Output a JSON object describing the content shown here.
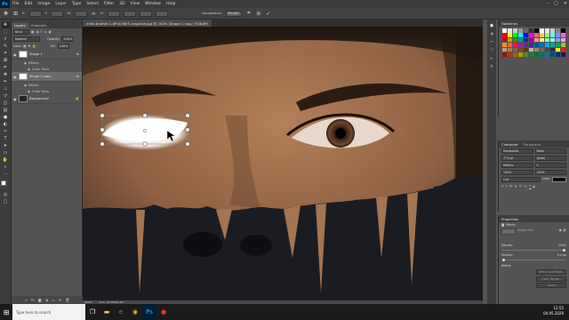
{
  "menubar": {
    "logo": "Ps",
    "items": [
      "File",
      "Edit",
      "Image",
      "Layer",
      "Type",
      "Select",
      "Filter",
      "3D",
      "View",
      "Window",
      "Help"
    ],
    "window_controls": [
      "–",
      "▢",
      "✕"
    ]
  },
  "options": {
    "fields": [
      "W:",
      "H:",
      "Y:"
    ],
    "interpolation_label": "Interpolation:",
    "interpolation_value": "Bicubic"
  },
  "tools": [
    "move-icon",
    "marquee-icon",
    "lasso-icon",
    "quick-select-icon",
    "crop-icon",
    "eyedropper-icon",
    "spot-heal-icon",
    "brush-icon",
    "stamp-icon",
    "history-brush-icon",
    "eraser-icon",
    "gradient-icon",
    "blur-icon",
    "dodge-icon",
    "pen-icon",
    "type-icon",
    "path-select-icon",
    "shape-icon",
    "hand-icon",
    "zoom-icon",
    "more-icon"
  ],
  "layers_panel": {
    "tabs": [
      "Layers",
      "Channels"
    ],
    "kind_label": "Kind",
    "blend_mode": "Normal",
    "opacity_label": "Opacity:",
    "opacity_value": "100%",
    "lock_label": "Lock:",
    "fill_label": "Fill:",
    "fill_value": "100%",
    "layers": [
      {
        "name": "Shape 1",
        "thumb": "white",
        "effects_label": "Effects",
        "effect": "Outer Glow"
      },
      {
        "name": "Shape 1 copy",
        "thumb": "white",
        "selected": true,
        "effects_label": "Effects",
        "effect": "Outer Glow"
      },
      {
        "name": "Background",
        "thumb": "dark"
      }
    ]
  },
  "document": {
    "tab_title": "male-brother-1-8PxE-INFF-unsplash.jpg @ 200% (Shape 1 copy, RGB/8*)",
    "zoom": "200%",
    "doc_info": "Doc: 12,3M/61,2M"
  },
  "swatches": {
    "title": "Swatches",
    "colors": [
      "#ffffff",
      "#e6e6e6",
      "#cccccc",
      "#999999",
      "#666666",
      "#333333",
      "#000000",
      "#ffffff",
      "#e6e6e6",
      "#cccccc",
      "#888888",
      "#000000",
      "#ff0000",
      "#ffff00",
      "#00ff00",
      "#00ffff",
      "#0000ff",
      "#ff00ff",
      "#ff6666",
      "#ffcc66",
      "#99ff66",
      "#66ffff",
      "#6699ff",
      "#ff66cc",
      "#cc0000",
      "#cc9900",
      "#339900",
      "#009999",
      "#003399",
      "#990099",
      "#ff9999",
      "#ffff99",
      "#99ff99",
      "#99ffff",
      "#9999ff",
      "#ff99ff",
      "#f7941d",
      "#f26522",
      "#ed145b",
      "#92278f",
      "#662d91",
      "#2e3192",
      "#0054a6",
      "#0072bc",
      "#00aeef",
      "#00a99d",
      "#00a651",
      "#8dc63f",
      "#c69c6d",
      "#a67c52",
      "#8c6239",
      "#754c24",
      "#603913",
      "#c7b299",
      "#998675",
      "#736357",
      "#534741",
      "#362f2d",
      "#fff200",
      "#ed1c24",
      "#9e0b0f",
      "#a0410d",
      "#a36209",
      "#aba000",
      "#598527",
      "#1a7b30",
      "#007236",
      "#00746b",
      "#0076a3",
      "#004b80",
      "#003471",
      "#1b1464"
    ]
  },
  "character": {
    "tabs": [
      "Character",
      "Paragraph"
    ],
    "font_family": "Montserrat",
    "font_style": "Black",
    "size": "77,5 pt",
    "leading": "(Auto)",
    "tracking_label": "Metrics",
    "kerning": "0",
    "scale_v": "100%",
    "scale_h": "100%",
    "baseline": "0 pt",
    "color_label": "Color:",
    "type_styles": [
      "T",
      "T",
      "TT",
      "Tr",
      "T¹",
      "T₁",
      "T",
      "T"
    ]
  },
  "properties": {
    "title": "Properties",
    "kind": "Masks",
    "mask_label": "Shape Path",
    "density_label": "Density:",
    "density_value": "100%",
    "feather_label": "Feather:",
    "feather_value": "0,0 px",
    "refine_label": "Refine:",
    "buttons": [
      "Select and Mask...",
      "Color Range...",
      "Invert"
    ]
  },
  "taskbar": {
    "search_placeholder": "Type here to search",
    "time": "12:55",
    "date": "04.05.2020"
  }
}
